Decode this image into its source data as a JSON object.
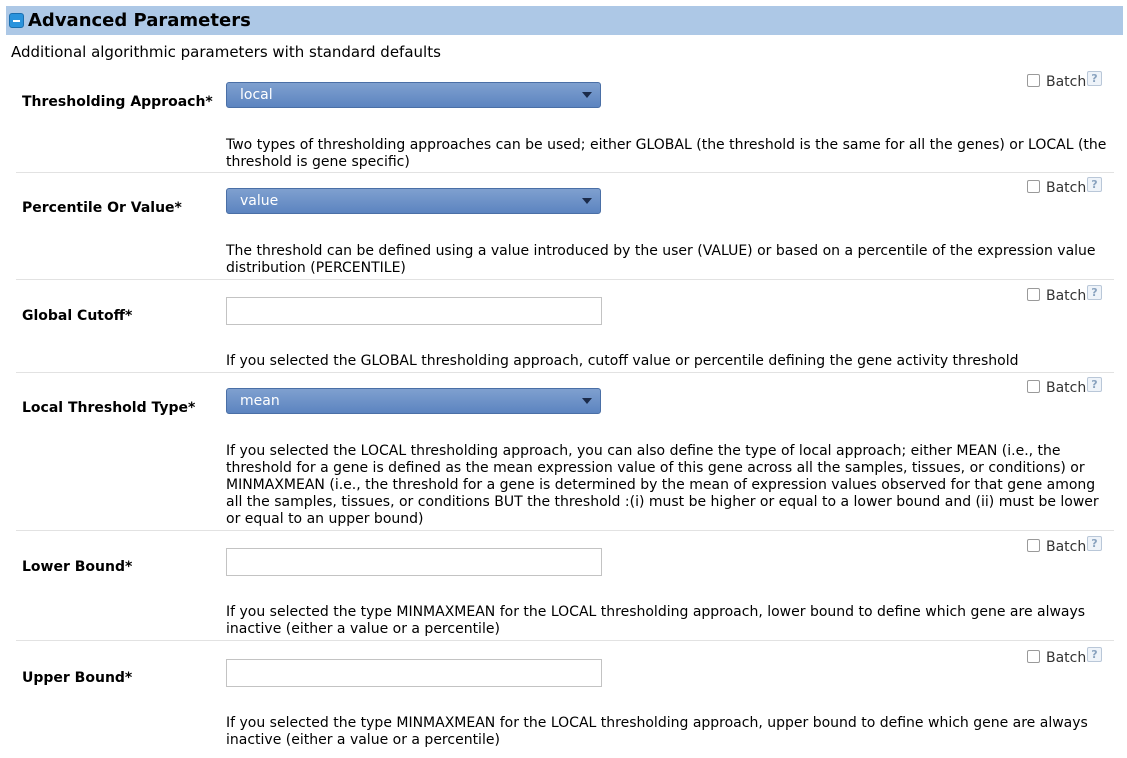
{
  "header": {
    "title": "Advanced Parameters",
    "subtitle": "Additional algorithmic parameters with standard defaults"
  },
  "params": [
    {
      "label": "Thresholding Approach*",
      "type": "select",
      "value": "local",
      "batch_label": "Batch",
      "help_icon": "?",
      "help_text": "Two types of thresholding approaches can be used; either GLOBAL (the threshold is the same for all the genes) or LOCAL (the threshold is gene specific)"
    },
    {
      "label": "Percentile Or Value*",
      "type": "select",
      "value": "value",
      "batch_label": "Batch",
      "help_icon": "?",
      "help_text": "The threshold can be defined using a value introduced by the user (VALUE) or based on a percentile of the expression value distribution (PERCENTILE)"
    },
    {
      "label": "Global Cutoff*",
      "type": "text",
      "value": "",
      "batch_label": "Batch",
      "help_icon": "?",
      "help_text": "If you selected the GLOBAL thresholding approach, cutoff value or percentile defining the gene activity threshold"
    },
    {
      "label": "Local Threshold Type*",
      "type": "select",
      "value": "mean",
      "batch_label": "Batch",
      "help_icon": "?",
      "help_text": "If you selected the LOCAL thresholding approach, you can also define the type of local approach; either MEAN (i.e., the threshold for a gene is defined as the mean expression value of this gene across all the samples, tissues, or conditions) or MINMAXMEAN (i.e., the threshold for a gene is determined by the mean of expression values observed for that gene among all the samples, tissues, or conditions BUT the threshold :(i) must be higher or equal to a lower bound and (ii) must be lower or equal to an upper bound)"
    },
    {
      "label": "Lower Bound*",
      "type": "text",
      "value": "",
      "batch_label": "Batch",
      "help_icon": "?",
      "help_text": "If you selected the type MINMAXMEAN for the LOCAL thresholding approach, lower bound to define which gene are always inactive (either a value or a percentile)"
    },
    {
      "label": "Upper Bound*",
      "type": "text",
      "value": "",
      "batch_label": "Batch",
      "help_icon": "?",
      "help_text": "If you selected the type MINMAXMEAN for the LOCAL thresholding approach, upper bound to define which gene are always inactive (either a value or a percentile)"
    }
  ],
  "colors": {
    "header_bg": "#adc8e6",
    "select_bg": "#6a8fc8",
    "collapse_icon": "#2a93dc"
  }
}
